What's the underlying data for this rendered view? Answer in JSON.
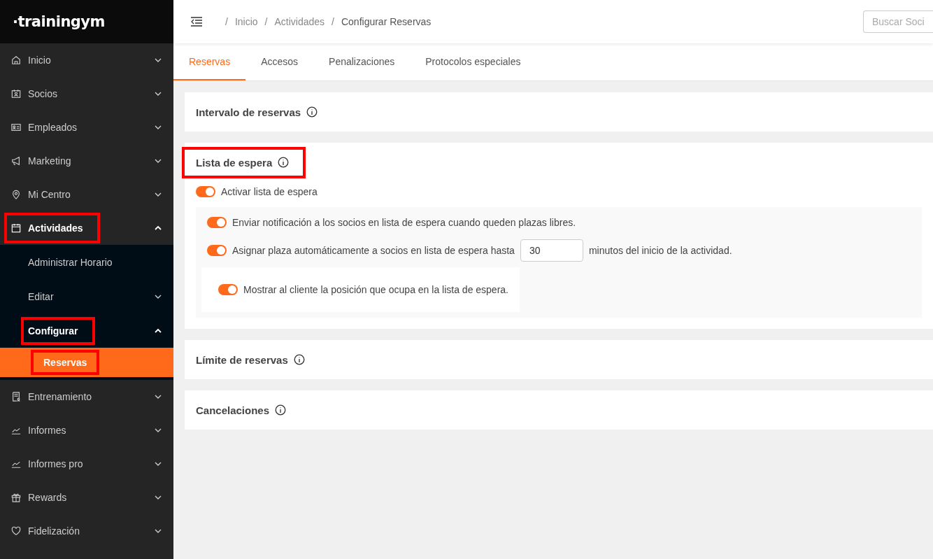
{
  "brand": {
    "logo": "·trainingym"
  },
  "sidebar": {
    "items": [
      {
        "label": "Inicio",
        "expanded": false,
        "highlighted": false
      },
      {
        "label": "Socios",
        "expanded": false,
        "highlighted": false
      },
      {
        "label": "Empleados",
        "expanded": false,
        "highlighted": false
      },
      {
        "label": "Marketing",
        "expanded": false,
        "highlighted": false
      },
      {
        "label": "Mi Centro",
        "expanded": false,
        "highlighted": false
      },
      {
        "label": "Actividades",
        "expanded": true,
        "highlighted": true,
        "children": [
          {
            "label": "Administrar Horario",
            "highlighted": false,
            "selected": false
          },
          {
            "label": "Editar",
            "expanded": false,
            "highlighted": false,
            "selected": false
          },
          {
            "label": "Configurar",
            "expanded": true,
            "highlighted": true,
            "selected": false,
            "children": [
              {
                "label": "Reservas",
                "highlighted": true,
                "selected": true
              }
            ]
          }
        ]
      },
      {
        "label": "Entrenamiento",
        "expanded": false,
        "highlighted": false
      },
      {
        "label": "Informes",
        "expanded": false,
        "highlighted": false
      },
      {
        "label": "Informes pro",
        "expanded": false,
        "highlighted": false
      },
      {
        "label": "Rewards",
        "expanded": false,
        "highlighted": false
      },
      {
        "label": "Fidelización",
        "expanded": false,
        "highlighted": false
      }
    ]
  },
  "breadcrumb": [
    {
      "separator": "/",
      "label": "Inicio"
    },
    {
      "separator": "/",
      "label": "Actividades"
    },
    {
      "separator": "/",
      "label": "Configurar Reservas"
    }
  ],
  "search": {
    "placeholder": "Buscar Soci"
  },
  "tabs": [
    {
      "label": "Reservas",
      "selected": true
    },
    {
      "label": "Accesos",
      "selected": false
    },
    {
      "label": "Penalizaciones",
      "selected": false
    },
    {
      "label": "Protocolos especiales",
      "selected": false
    }
  ],
  "sections": [
    {
      "title": "Intervalo de reservas",
      "highlighted": false
    },
    {
      "title": "Lista de espera",
      "highlighted": true,
      "activate": {
        "label": "Activar lista de espera",
        "on": true
      },
      "options": [
        {
          "kind": "toggle",
          "label": "Enviar notificación a los socios en lista de espera cuando queden plazas libres.",
          "on": true
        },
        {
          "kind": "toggle-input",
          "label": "Asignar plaza automáticamente a socios en lista de espera hasta",
          "value": "30",
          "suffix": "minutos del inicio de la actividad.",
          "on": true
        },
        {
          "kind": "toggle-card",
          "label": "Mostrar al cliente la posición que ocupa en la lista de espera.",
          "on": true
        }
      ]
    },
    {
      "title": "Límite de reservas",
      "highlighted": false
    },
    {
      "title": "Cancelaciones",
      "highlighted": false
    }
  ]
}
